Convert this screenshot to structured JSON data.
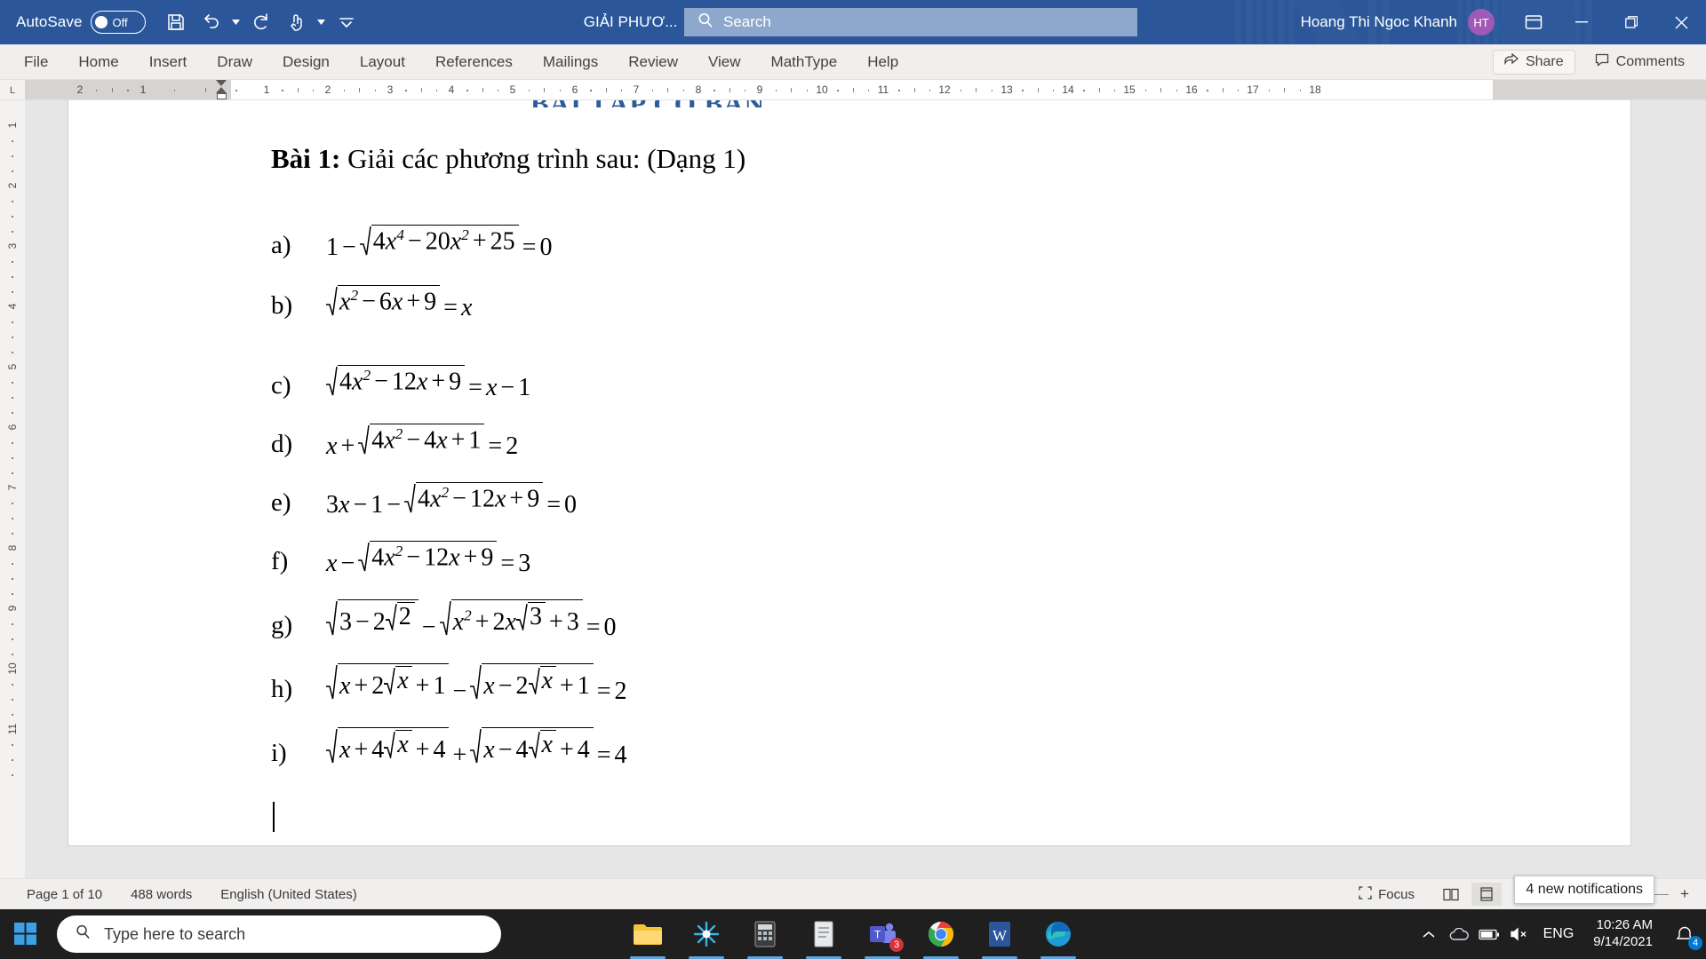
{
  "titlebar": {
    "autosave_label": "AutoSave",
    "autosave_state": "Off",
    "save_icon": "save-icon",
    "undo_icon": "undo-icon",
    "redo_icon": "redo-icon",
    "touch_icon": "touch-mode-icon",
    "customize_icon": "customize-quick-access-toolbar-icon",
    "document_title": "GIẢI PHƯƠ...",
    "title_caret": "▼",
    "search_icon": "search-icon",
    "search_placeholder": "Search",
    "user_name": "Hoang Thi Ngoc Khanh",
    "avatar_initials": "HT",
    "ribbon_display_icon": "ribbon-display-options-icon",
    "minimize": "minimize-icon",
    "restore": "restore-icon",
    "close": "close-icon",
    "accent_color": "#2b579a"
  },
  "ribbon": {
    "tabs": [
      {
        "label": "File"
      },
      {
        "label": "Home"
      },
      {
        "label": "Insert"
      },
      {
        "label": "Draw"
      },
      {
        "label": "Design"
      },
      {
        "label": "Layout"
      },
      {
        "label": "References"
      },
      {
        "label": "Mailings"
      },
      {
        "label": "Review"
      },
      {
        "label": "View"
      },
      {
        "label": "MathType"
      },
      {
        "label": "Help"
      }
    ],
    "share_label": "Share",
    "comments_label": "Comments"
  },
  "ruler": {
    "corner_label": "L",
    "numbers": [
      {
        "label": "2",
        "pos": 62
      },
      {
        "label": "1",
        "pos": 133
      },
      {
        "label": "1",
        "pos": 272
      },
      {
        "label": "2",
        "pos": 341
      },
      {
        "label": "3",
        "pos": 411
      },
      {
        "label": "4",
        "pos": 480
      },
      {
        "label": "5",
        "pos": 549
      },
      {
        "label": "6",
        "pos": 619
      },
      {
        "label": "7",
        "pos": 688
      },
      {
        "label": "8",
        "pos": 758
      },
      {
        "label": "9",
        "pos": 827
      },
      {
        "label": "10",
        "pos": 897
      },
      {
        "label": "11",
        "pos": 966
      },
      {
        "label": "12",
        "pos": 1035
      },
      {
        "label": "13",
        "pos": 1105
      },
      {
        "label": "14",
        "pos": 1174
      },
      {
        "label": "15",
        "pos": 1243
      },
      {
        "label": "16",
        "pos": 1313
      },
      {
        "label": "17",
        "pos": 1382
      },
      {
        "label": "18",
        "pos": 1452
      }
    ],
    "vertical_numbers": [
      "1",
      "2",
      "3",
      "4",
      "5",
      "6",
      "7",
      "8",
      "9",
      "10",
      "11"
    ]
  },
  "document": {
    "clipped_heading": "BÀI TẬP CƠ BẢN",
    "exercise_label": "Bài 1:",
    "exercise_text": "Giải các phương trình sau: (Dạng 1)",
    "equations": [
      {
        "label": "a)",
        "text": "1 − √(4x⁴ − 20x² + 25) = 0"
      },
      {
        "label": "b)",
        "text": "√(x² − 6x + 9) = x"
      },
      {
        "label": "c)",
        "text": "√(4x² − 12x + 9) = x − 1"
      },
      {
        "label": "d)",
        "text": "x + √(4x² − 4x + 1) = 2"
      },
      {
        "label": "e)",
        "text": "3x − 1 − √(4x² − 12x + 9) = 0"
      },
      {
        "label": "f)",
        "text": "x − √(4x² − 12x + 9) = 3"
      },
      {
        "label": "g)",
        "text": "√(3 − 2√2) − √(x² + 2x√3 + 3) = 0"
      },
      {
        "label": "h)",
        "text": "√(x + 2√x + 1) − √(x − 2√x + 1) = 2"
      },
      {
        "label": "i)",
        "text": "√(x + 4√x + 4) + √(x − 4√x + 4) = 4"
      }
    ]
  },
  "statusbar": {
    "page_info": "Page 1 of 10",
    "word_count": "488 words",
    "language": "English (United States)",
    "focus_label": "Focus",
    "read_mode_icon": "read-mode-icon",
    "print_layout_icon": "print-layout-icon",
    "web_layout_icon": "web-layout-icon",
    "zoom_out": "−",
    "zoom_in": "+",
    "notification_toast": "4 new notifications"
  },
  "taskbar": {
    "start_icon": "windows-start-icon",
    "search_icon": "search-icon",
    "search_placeholder": "Type here to search",
    "apps": [
      {
        "name": "file-explorer",
        "badge": ""
      },
      {
        "name": "photos-app",
        "badge": ""
      },
      {
        "name": "calculator-app",
        "badge": ""
      },
      {
        "name": "notepad-app",
        "badge": ""
      },
      {
        "name": "microsoft-teams",
        "badge": "3"
      },
      {
        "name": "google-chrome",
        "badge": ""
      },
      {
        "name": "microsoft-word",
        "badge": ""
      },
      {
        "name": "microsoft-edge",
        "badge": ""
      }
    ],
    "show_hidden_icons": "chevron-up-icon",
    "onedrive_icon": "cloud-icon",
    "battery_icon": "battery-icon",
    "volume_icon": "volume-muted-icon",
    "language": "ENG",
    "time": "10:26 AM",
    "date": "9/14/2021",
    "notification_count": "4"
  }
}
